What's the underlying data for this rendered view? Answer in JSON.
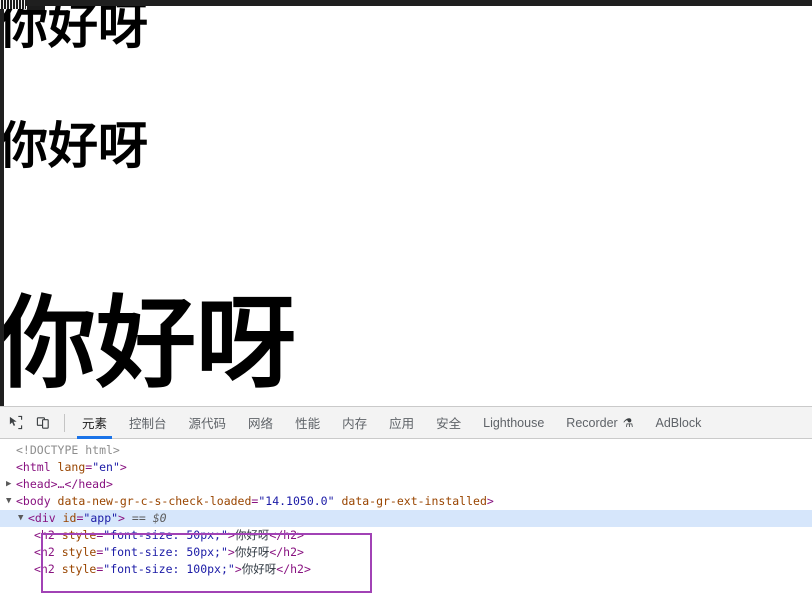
{
  "page": {
    "headings": [
      {
        "text": "你好呀",
        "font_size": "50px"
      },
      {
        "text": "你好呀",
        "font_size": "50px"
      },
      {
        "text": "你好呀",
        "font_size": "100px"
      }
    ]
  },
  "devtools": {
    "toolbar": {
      "inspect_icon": "inspect-cursor-icon",
      "device_toolbar_icon": "device-toolbar-icon"
    },
    "tabs": [
      {
        "label": "元素",
        "active": true,
        "icon": null
      },
      {
        "label": "控制台",
        "active": false,
        "icon": null
      },
      {
        "label": "源代码",
        "active": false,
        "icon": null
      },
      {
        "label": "网络",
        "active": false,
        "icon": null
      },
      {
        "label": "性能",
        "active": false,
        "icon": null
      },
      {
        "label": "内存",
        "active": false,
        "icon": null
      },
      {
        "label": "应用",
        "active": false,
        "icon": null
      },
      {
        "label": "安全",
        "active": false,
        "icon": null
      },
      {
        "label": "Lighthouse",
        "active": false,
        "icon": null
      },
      {
        "label": "Recorder",
        "active": false,
        "icon": "flask-icon",
        "icon_glyph": "⚗"
      },
      {
        "label": "AdBlock",
        "active": false,
        "icon": null
      }
    ],
    "dom": {
      "doctype": "<!DOCTYPE html>",
      "html_open": {
        "tag_open": "<html ",
        "attr_name": "lang",
        "attr_eq": "=",
        "attr_value": "\"en\"",
        "tag_close": ">"
      },
      "head_line": {
        "open": "<head>",
        "ellipsis": "…",
        "close": "</head>"
      },
      "body_open": {
        "tag_open": "<body ",
        "attr1_name": "data-new-gr-c-s-check-loaded",
        "attr1_eq": "=",
        "attr1_value": "\"14.1050.0\"",
        "attr2_name": "data-gr-ext-installed",
        "tag_close": ">"
      },
      "div_app": {
        "tag_open": "<div ",
        "attr_name": "id",
        "attr_eq": "=",
        "attr_value": "\"app\"",
        "tag_close": ">",
        "ref_marker": "== $0",
        "selected": true
      },
      "h2_lines": [
        {
          "tag_open": "<h2 ",
          "attr_name": "style",
          "attr_eq": "=",
          "attr_value": "\"font-size: 50px;\"",
          "tag_close": ">",
          "text": "你好呀",
          "tag_end": "</h2>"
        },
        {
          "tag_open": "<h2 ",
          "attr_name": "style",
          "attr_eq": "=",
          "attr_value": "\"font-size: 50px;\"",
          "tag_close": ">",
          "text": "你好呀",
          "tag_end": "</h2>"
        },
        {
          "tag_open": "<h2 ",
          "attr_name": "style",
          "attr_eq": "=",
          "attr_value": "\"font-size: 100px;\"",
          "tag_close": ">",
          "text": "你好呀",
          "tag_end": "</h2>"
        }
      ],
      "triangle_expanded": "▼",
      "triangle_collapsed": "▶"
    },
    "colors": {
      "tag": "#881280",
      "attribute_name": "#994500",
      "attribute_value": "#1a1aa6",
      "doctype": "#8d8d8d",
      "selection_row": "#d6e6fb",
      "subtree_outline": "#a142b5",
      "active_tab_underline": "#1a73e8",
      "tabbar_background": "#f3f3f3"
    }
  }
}
